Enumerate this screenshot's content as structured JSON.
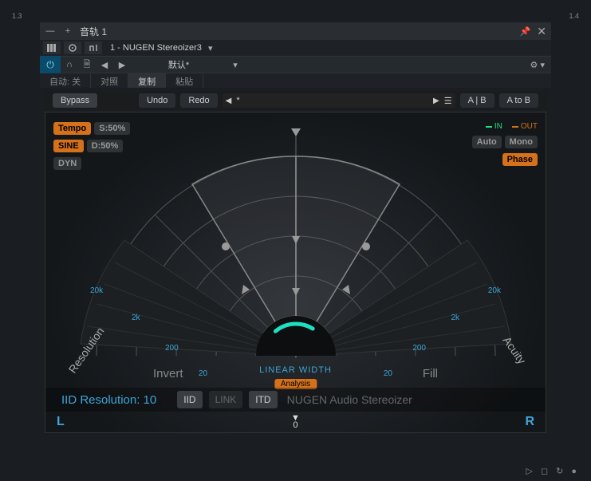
{
  "ruler": {
    "left": "1.3",
    "right": "1.4"
  },
  "track": {
    "dash": "—",
    "plus": "+",
    "title": "音轨 1"
  },
  "toolbar2": {
    "plugin": "1 - NUGEN Stereoizer3"
  },
  "toolbar3": {
    "preset": "默认*"
  },
  "tabs": {
    "auto": "自动: 关",
    "contrast": "对照",
    "copy": "复制",
    "paste": "粘贴"
  },
  "pluginbar": {
    "bypass": "Bypass",
    "undo": "Undo",
    "redo": "Redo",
    "ab": "A | B",
    "atob": "A to B",
    "star": "*"
  },
  "leftparams": {
    "tempo": "Tempo",
    "s": "S:50%",
    "sine": "SINE",
    "d": "D:50%",
    "dyn": "DYN"
  },
  "rightparams": {
    "in": "IN",
    "out": "OUT",
    "auto": "Auto",
    "mono": "Mono",
    "phase": "Phase"
  },
  "arc": {
    "linear_width": "LINEAR WIDTH",
    "analysis": "Analysis",
    "invert": "Invert",
    "fill": "Fill",
    "resolution": "Resolution",
    "acuity": "Acuity",
    "freqs": [
      "20",
      "200",
      "2k",
      "20k"
    ]
  },
  "infobar": {
    "label_prefix": "IID Resolution: ",
    "value": "10",
    "iid": "IID",
    "link": "LINK",
    "itd": "ITD",
    "brand": "NUGEN Audio Stereoizer"
  },
  "lrbar": {
    "L": "L",
    "R": "R",
    "zero": "0"
  }
}
